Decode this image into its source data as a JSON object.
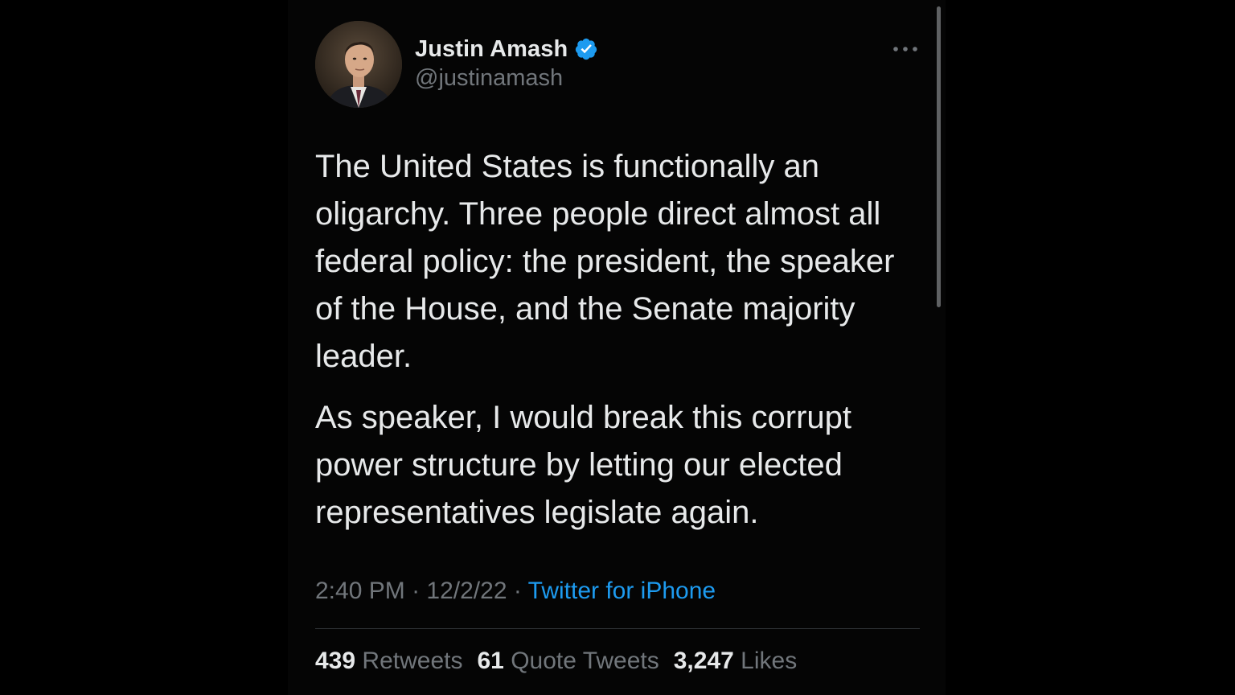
{
  "author": {
    "display_name": "Justin Amash",
    "handle": "@justinamash",
    "verified": true,
    "avatar_icon": "profile-photo"
  },
  "tweet": {
    "paragraphs": [
      "The United States is functionally an oligarchy. Three people direct almost all federal policy: the president, the speaker of the House, and the Senate majority leader.",
      "As speaker, I would break this corrupt power structure by letting our elected representatives legislate again."
    ],
    "time": "2:40 PM",
    "date": "12/2/22",
    "separator": "·",
    "source": "Twitter for iPhone"
  },
  "stats": {
    "retweets": {
      "count": "439",
      "label": "Retweets"
    },
    "quote_tweets": {
      "count": "61",
      "label": "Quote Tweets"
    },
    "likes": {
      "count": "3,247",
      "label": "Likes"
    }
  },
  "icons": {
    "verified": "verified-badge-icon",
    "more": "more-options-icon"
  },
  "colors": {
    "background": "#000000",
    "text_primary": "#e7e9ea",
    "text_secondary": "#71767b",
    "accent": "#1d9bf0",
    "divider": "#2f3336"
  }
}
